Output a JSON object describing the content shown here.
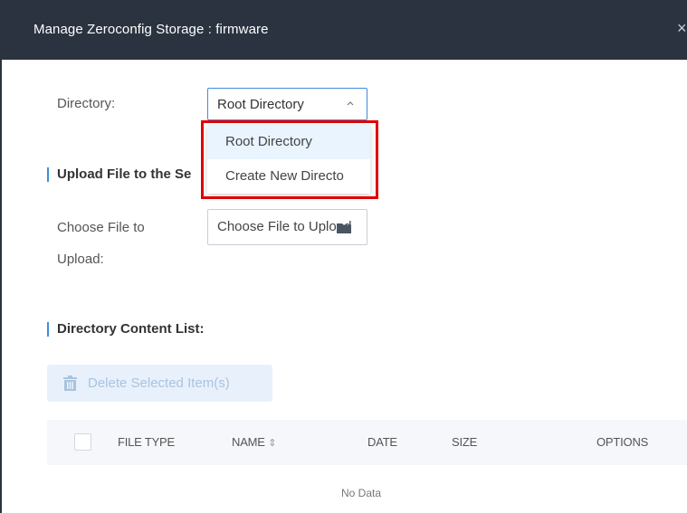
{
  "dialog": {
    "title": "Manage Zeroconfig Storage : firmware",
    "close_glyph": "×"
  },
  "directory": {
    "label": "Directory:",
    "selected": "Root Directory",
    "options": [
      "Root Directory",
      "Create New Directo"
    ]
  },
  "upload": {
    "section_title": "Upload File to the Se",
    "label_line1": "Choose File to",
    "label_line2": "Upload:",
    "input_value": "Choose File to Upload",
    "icon": "folder-icon"
  },
  "content_list": {
    "section_title": "Directory Content List:",
    "delete_button": "Delete Selected Item(s)",
    "delete_icon": "trash-icon",
    "columns": [
      "FILE TYPE",
      "NAME",
      "DATE",
      "SIZE",
      "OPTIONS"
    ],
    "sort_glyph": "⇕",
    "empty_text": "No Data"
  },
  "colors": {
    "header_bg": "#2b3340",
    "accent": "#3d8de0",
    "highlight": "#e00000"
  }
}
